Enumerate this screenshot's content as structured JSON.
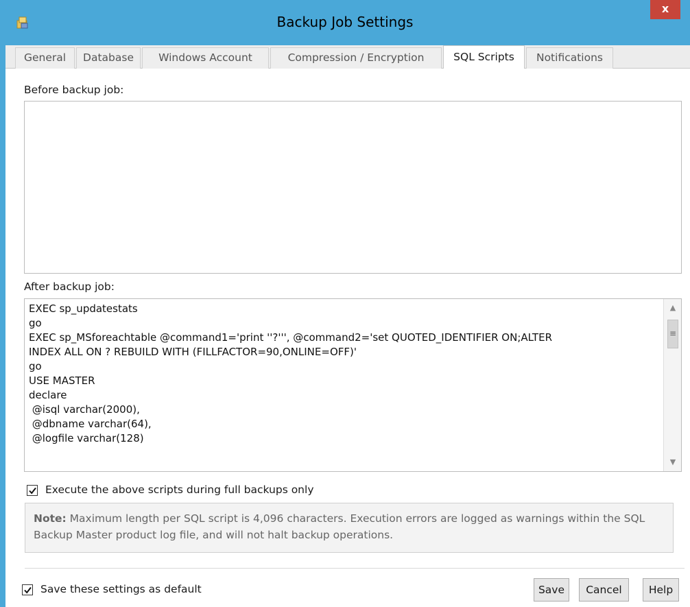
{
  "window": {
    "title": "Backup Job Settings",
    "close_label": "x"
  },
  "tabs": [
    {
      "label": "General"
    },
    {
      "label": "Database"
    },
    {
      "label": "Windows Account"
    },
    {
      "label": "Compression / Encryption"
    },
    {
      "label": "SQL Scripts",
      "active": true
    },
    {
      "label": "Notifications"
    }
  ],
  "before_backup": {
    "label": "Before backup job:",
    "value": ""
  },
  "after_backup": {
    "label": "After backup job:",
    "value": "EXEC sp_updatestats\ngo\nEXEC sp_MSforeachtable @command1='print ''?''', @command2='set QUOTED_IDENTIFIER ON;ALTER\nINDEX ALL ON ? REBUILD WITH (FILLFACTOR=90,ONLINE=OFF)'\ngo\nUSE MASTER\ndeclare\n @isql varchar(2000),\n @dbname varchar(64),\n @logfile varchar(128)"
  },
  "full_backups_only": {
    "label": "Execute the above scripts during full backups only",
    "checked": true
  },
  "note": {
    "prefix": "Note:",
    "text": " Maximum length per SQL script is 4,096 characters. Execution errors are logged as warnings within the SQL Backup Master product log file, and will not halt backup operations."
  },
  "save_default": {
    "label": "Save these settings as default",
    "checked": true
  },
  "buttons": {
    "save": "Save",
    "cancel": "Cancel",
    "help": "Help"
  },
  "colors": {
    "titlebar": "#4aa8d8",
    "close": "#c7453a"
  }
}
